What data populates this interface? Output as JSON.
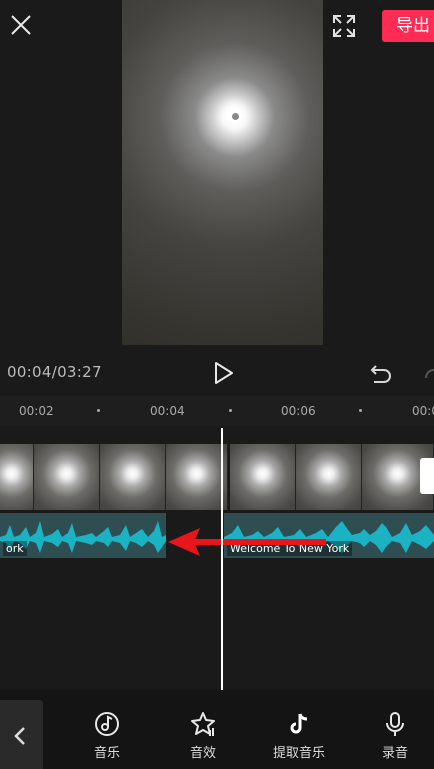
{
  "top_bar": {
    "export_label": "导出",
    "close_icon": "close-icon",
    "fullscreen_icon": "fullscreen-icon"
  },
  "playback": {
    "time": "00:04/03:27",
    "play_icon": "play-icon",
    "undo_icon": "undo-icon",
    "redo_icon": "redo-icon"
  },
  "timeline": {
    "ticks": [
      "00:02",
      "00:04",
      "00:06",
      "00:0"
    ],
    "audio_clips": [
      "ork",
      "Welcome To New York"
    ],
    "audio_color": "#1bb3c4"
  },
  "toolbar": {
    "items": [
      {
        "label": "音乐",
        "icon": "music-disc-icon"
      },
      {
        "label": "音效",
        "icon": "sound-effect-star-icon"
      },
      {
        "label": "提取音乐",
        "icon": "tiktok-note-icon"
      },
      {
        "label": "录音",
        "icon": "microphone-icon"
      }
    ],
    "back_icon": "chevron-left-icon"
  },
  "colors": {
    "accent": "#fe2c55",
    "background": "#1a1a1a",
    "waveform": "#1bb3c4",
    "arrow": "#e8151b"
  }
}
